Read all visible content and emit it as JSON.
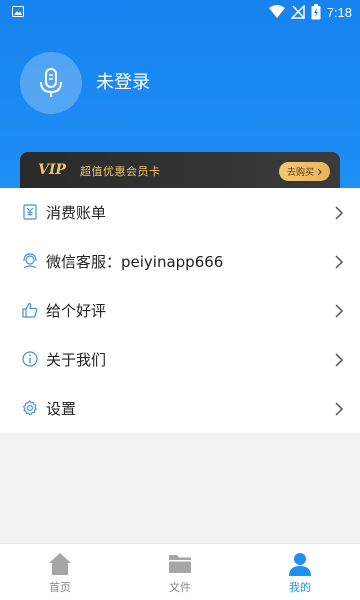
{
  "status_bar": {
    "time": "7:18"
  },
  "profile": {
    "login_text": "未登录"
  },
  "vip_banner": {
    "logo": "VIP",
    "text": "超值优惠会员卡",
    "button": "去购买"
  },
  "menu": {
    "items": [
      {
        "label": "消费账单",
        "icon": "receipt-icon"
      },
      {
        "label": "微信客服：peiyinapp666",
        "icon": "customer-service-icon"
      },
      {
        "label": "给个好评",
        "icon": "thumbs-up-icon"
      },
      {
        "label": "关于我们",
        "icon": "info-icon"
      },
      {
        "label": "设置",
        "icon": "gear-icon"
      }
    ]
  },
  "bottom_nav": {
    "items": [
      {
        "label": "首页",
        "icon": "home-icon"
      },
      {
        "label": "文件",
        "icon": "folder-icon"
      },
      {
        "label": "我的",
        "icon": "person-icon"
      }
    ],
    "active": "我的"
  },
  "colors": {
    "header": "#1783f0",
    "accent": "#1e90f0",
    "vip_gold": "#f1c46b",
    "page_bg": "#f2f2f2"
  }
}
